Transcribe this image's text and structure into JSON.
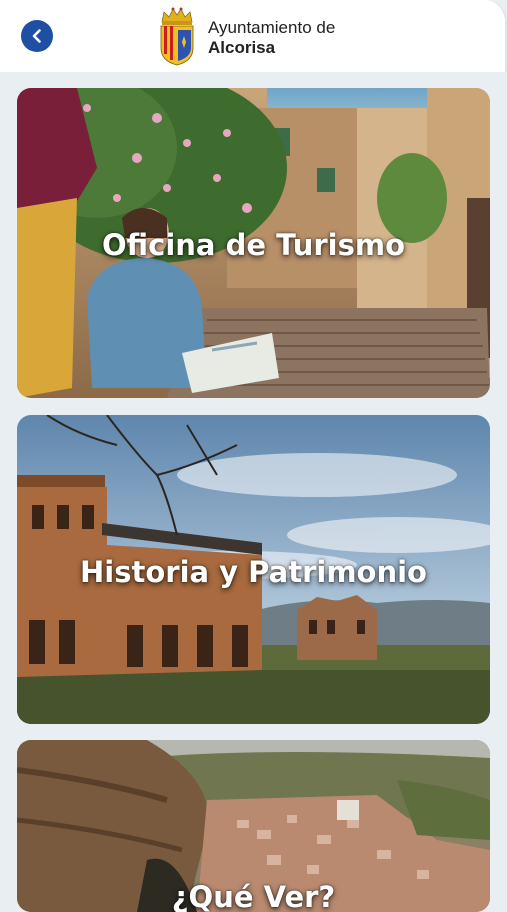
{
  "header": {
    "back_icon": "chevron-left-icon",
    "crest_icon": "coat-of-arms-icon",
    "brand_line1": "Ayuntamiento de",
    "brand_line2": "Alcorisa",
    "accent_color": "#1e4fa5"
  },
  "cards": [
    {
      "title": "Oficina de Turismo"
    },
    {
      "title": "Historia y Patrimonio"
    },
    {
      "title": "¿Qué Ver?"
    }
  ]
}
